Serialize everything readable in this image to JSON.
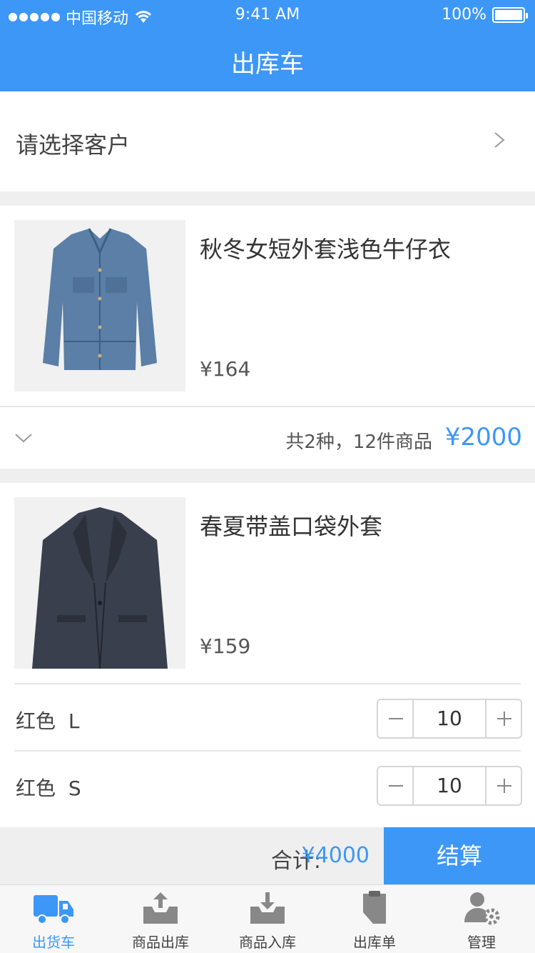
{
  "status_bar": {
    "carrier": "中国移动",
    "time": "9:41 AM",
    "battery": "100%"
  },
  "header": {
    "title": "出库车"
  },
  "customer": {
    "label": "请选择客户"
  },
  "products": [
    {
      "name": "秋冬女短外套浅色牛仔衣",
      "price": "¥164",
      "summary_count": "共2种，12件商品",
      "summary_amount": "¥2000"
    },
    {
      "name": "春夏带盖口袋外套",
      "price": "¥159",
      "variants": [
        {
          "color": "红色",
          "size": "L",
          "quantity": "10"
        },
        {
          "color": "红色",
          "size": "S",
          "quantity": "10"
        }
      ]
    }
  ],
  "footer": {
    "total_label": "合计:",
    "total_amount": "¥4000",
    "checkout_label": "结算"
  },
  "tabs": [
    {
      "label": "出货车",
      "icon": "truck-icon",
      "active": true
    },
    {
      "label": "商品出库",
      "icon": "box-upload-icon",
      "active": false
    },
    {
      "label": "商品入库",
      "icon": "box-download-icon",
      "active": false
    },
    {
      "label": "出库单",
      "icon": "document-icon",
      "active": false
    },
    {
      "label": "管理",
      "icon": "user-settings-icon",
      "active": false
    }
  ],
  "colors": {
    "accent": "#3d97f7"
  }
}
